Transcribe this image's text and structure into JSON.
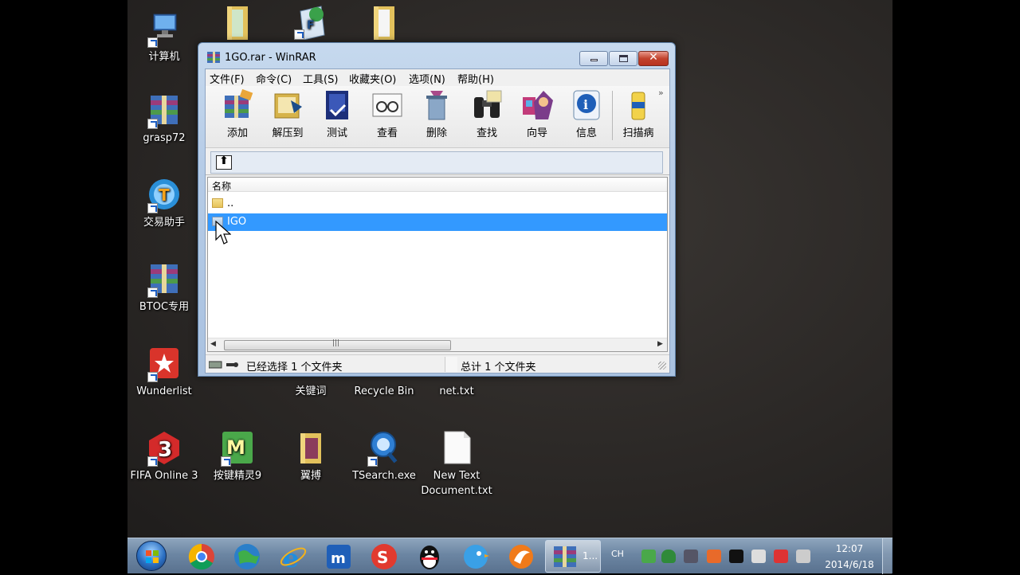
{
  "desktop": {
    "icons": [
      {
        "label": "计算机",
        "icon": "computer-icon"
      },
      {
        "label": "grasp72",
        "icon": "winrar-archive-icon"
      },
      {
        "label": "交易助手",
        "icon": "trade-assistant-icon"
      },
      {
        "label": "BTOC专用",
        "icon": "winrar-archive-icon"
      },
      {
        "label": "Wunderlist",
        "icon": "wunderlist-icon"
      },
      {
        "label": "FIFA Online 3",
        "icon": "fifa-icon"
      },
      {
        "label": "按键精灵9",
        "icon": "anjian-icon"
      },
      {
        "label": "翼搏",
        "icon": "folder-icon"
      },
      {
        "label": "TSearch.exe",
        "icon": "tsearch-icon"
      },
      {
        "label": "New Text Document.txt",
        "icon": "text-file-icon"
      },
      {
        "label": "关键词",
        "icon": "folder-icon"
      },
      {
        "label": "Recycle Bin",
        "icon": "recycle-bin-icon"
      },
      {
        "label": "net.txt",
        "icon": "text-file-icon"
      }
    ]
  },
  "window": {
    "title": "1GO.rar - WinRAR",
    "menu": [
      "文件(F)",
      "命令(C)",
      "工具(S)",
      "收藏夹(O)",
      "选项(N)",
      "帮助(H)"
    ],
    "toolbar": [
      "添加",
      "解压到",
      "测试",
      "查看",
      "删除",
      "查找",
      "向导",
      "信息",
      "扫描病"
    ],
    "column_header": "名称",
    "files": [
      {
        "name": "..",
        "selected": false
      },
      {
        "name": "IGO",
        "selected": true
      }
    ],
    "status_left": "已经选择 1 个文件夹",
    "status_right": "总计 1 个文件夹"
  },
  "taskbar": {
    "pinned": [
      "start-orb",
      "chrome-icon",
      "globe-icon",
      "ie-icon",
      "maxthon-icon",
      "sogou-icon",
      "qq-icon",
      "bird-icon",
      "app-icon"
    ],
    "active_task_label": "1...",
    "language": "CH",
    "time": "12:07",
    "date": "2014/6/18"
  },
  "colors": {
    "selection": "#3399ff",
    "taskbar": "#6c86a3",
    "titlebar": "#b5cbe6",
    "close_button": "#c2432e"
  }
}
